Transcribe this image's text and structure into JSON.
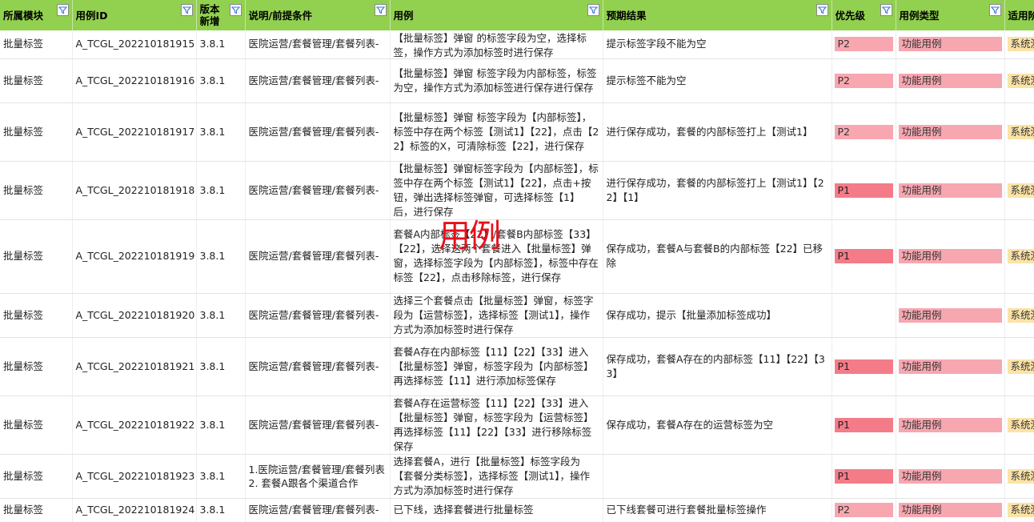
{
  "columns": [
    "所属模块",
    "用例ID",
    "版本新增",
    "说明/前提条件",
    "用例",
    "预期结果",
    "优先级",
    "用例类型",
    "适用阶"
  ],
  "overlay_text": "用例",
  "rows": [
    {
      "module": "批量标签",
      "id": "A_TCGL_202210181915",
      "version": "3.8.1",
      "precondition": "医院运营/套餐管理/套餐列表-",
      "case": "【批量标签】弹窗 的标签字段为空，选择标签，操作方式为添加标签时进行保存",
      "expected": "提示标签字段不能为空",
      "priority": "P2",
      "type": "功能用例",
      "stage": "系统测试"
    },
    {
      "module": "批量标签",
      "id": "A_TCGL_202210181916",
      "version": "3.8.1",
      "precondition": "医院运营/套餐管理/套餐列表-",
      "case": "【批量标签】弹窗 标签字段为内部标签，标签为空，操作方式为添加标签进行保存进行保存",
      "expected": "提示标签不能为空",
      "priority": "P2",
      "type": "功能用例",
      "stage": "系统测试"
    },
    {
      "module": "批量标签",
      "id": "A_TCGL_202210181917",
      "version": "3.8.1",
      "precondition": "医院运营/套餐管理/套餐列表-",
      "case": "【批量标签】弹窗 标签字段为【内部标签】，标签中存在两个标签【测试1】【22】，点击【22】标签的X，可清除标签【22】，进行保存",
      "expected": "进行保存成功，套餐的内部标签打上【测试1】",
      "priority": "P2",
      "type": "功能用例",
      "stage": "系统测试"
    },
    {
      "module": "批量标签",
      "id": "A_TCGL_202210181918",
      "version": "3.8.1",
      "precondition": "医院运营/套餐管理/套餐列表-",
      "case": "【批量标签】弹窗标签字段为【内部标签】，标签中存在两个标签【测试1】【22】，点击+按钮，弹出选择标签弹窗，可选择标签【1】后，进行保存",
      "expected": "进行保存成功，套餐的内部标签打上【测试1】【22】【1】",
      "priority": "P1",
      "type": "功能用例",
      "stage": "系统测试"
    },
    {
      "module": "批量标签",
      "id": "A_TCGL_202210181919",
      "version": "3.8.1",
      "precondition": "医院运营/套餐管理/套餐列表-",
      "case": "套餐A内部标签【22】/套餐B内部标签【33】【22】，选择这两个套餐进入【批量标签】弹窗，选择标签字段为【内部标签】，标签中存在标签【22】，点击移除标签，进行保存",
      "expected": "保存成功，套餐A与套餐B的内部标签【22】已移除",
      "priority": "P1",
      "type": "功能用例",
      "stage": "系统测试"
    },
    {
      "module": "批量标签",
      "id": "A_TCGL_202210181920",
      "version": "3.8.1",
      "precondition": "医院运营/套餐管理/套餐列表-",
      "case": "选择三个套餐点击【批量标签】弹窗，标签字段为【运营标签】，选择标签【测试1】，操作方式为添加标签时进行保存",
      "expected": "保存成功，提示【批量添加标签成功】",
      "priority": "",
      "type": "功能用例",
      "stage": "系统测试"
    },
    {
      "module": "批量标签",
      "id": "A_TCGL_202210181921",
      "version": "3.8.1",
      "precondition": "医院运营/套餐管理/套餐列表-",
      "case": "套餐A存在内部标签【11】【22】【33】进入【批量标签】弹窗，标签字段为【内部标签】再选择标签【11】进行添加标签保存",
      "expected": "保存成功，套餐A存在的内部标签【11】【22】【33】",
      "priority": "P1",
      "type": "功能用例",
      "stage": "系统测试"
    },
    {
      "module": "批量标签",
      "id": "A_TCGL_202210181922",
      "version": "3.8.1",
      "precondition": "医院运营/套餐管理/套餐列表-",
      "case": "套餐A存在运营标签【11】【22】【33】进入【批量标签】弹窗，标签字段为【运营标签】再选择标签【11】【22】【33】进行移除标签保存",
      "expected": "保存成功，套餐A存在的运营标签为空",
      "priority": "P1",
      "type": "功能用例",
      "stage": "系统测试"
    },
    {
      "module": "批量标签",
      "id": "A_TCGL_202210181923",
      "version": "3.8.1",
      "precondition": "1.医院运营/套餐管理/套餐列表\n2. 套餐A跟各个渠道合作",
      "case": "选择套餐A，进行【批量标签】标签字段为【套餐分类标签】，选择标签【测试1】，操作方式为添加标签时进行保存",
      "expected": "",
      "priority": "P1",
      "type": "功能用例",
      "stage": "系统测试"
    },
    {
      "module": "批量标签",
      "id": "A_TCGL_202210181924",
      "version": "3.8.1",
      "precondition": "医院运营/套餐管理/套餐列表-",
      "case": "已下线，选择套餐进行批量标签",
      "expected": "已下线套餐可进行套餐批量标签操作",
      "priority": "P2",
      "type": "功能用例",
      "stage": "系统测试"
    }
  ]
}
